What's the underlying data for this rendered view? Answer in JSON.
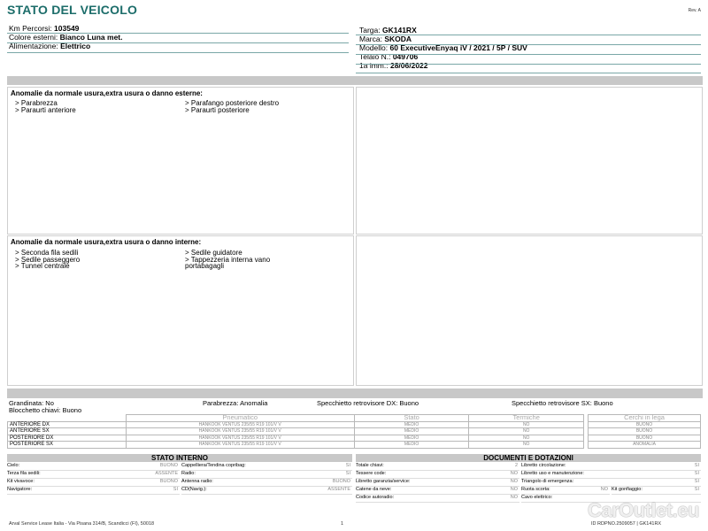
{
  "header": {
    "title": "STATO DEL VEICOLO",
    "rev": "Rev. A"
  },
  "vehicle_left": [
    {
      "label": "Km Percorsi:",
      "value": "103549"
    },
    {
      "label": "Colore esterni:",
      "value": "Bianco Luna met."
    },
    {
      "label": "Alimentazione:",
      "value": "Elettrico"
    }
  ],
  "vehicle_right": [
    {
      "label": "Targa:",
      "value": "GK141RX"
    },
    {
      "label": "Marca:",
      "value": "SKODA"
    },
    {
      "label": "Modello:",
      "value": "60 ExecutiveEnyaq iV / 2021 / 5P / SUV"
    },
    {
      "label": "Telaio N.:",
      "value": "049706"
    },
    {
      "label": "1a imm.:",
      "value": "28/06/2022"
    }
  ],
  "external": {
    "title": "Anomalie da normale usura,extra usura o danno esterne:",
    "col1": [
      "> Parabrezza",
      "> Paraurti anteriore"
    ],
    "col2": [
      "> Parafango posteriore destro",
      "> Paraurti posteriore"
    ]
  },
  "internal": {
    "title": "Anomalie da normale usura,extra usura o danno interne:",
    "col1": [
      "> Seconda fila sedili",
      "> Sedile passeggero",
      "> Tunnel centrale"
    ],
    "col2": [
      "> Sedile guidatore",
      "> Tappezzeria interna vano",
      "portabagagli"
    ]
  },
  "summary": {
    "grandinata": "Grandinata: No",
    "parabrezza": "Parabrezza: Anomalia",
    "specchietto_dx": "Specchietto retrovisore DX: Buono",
    "specchietto_sx": "Specchietto retrovisore SX: Buono",
    "blocchetto": "Blocchetto chiavi: Buono"
  },
  "tyres": {
    "headers": [
      "Pneumatico",
      "Stato",
      "Termiche"
    ],
    "rims_header": "Cerchi in lega",
    "rows": [
      {
        "pos": "ANTERIORE DX",
        "model": "HANKOOK VENTUS 235/55 R19 101/V V",
        "stato": "MEDIO",
        "termiche": "NO",
        "cerchi": "BUONO"
      },
      {
        "pos": "ANTERIORE SX",
        "model": "HANKOOK VENTUS 235/55 R19 101/V V",
        "stato": "MEDIO",
        "termiche": "NO",
        "cerchi": "BUONO"
      },
      {
        "pos": "POSTERIORE DX",
        "model": "HANKOOK VENTUS 235/55 R19 101/V V",
        "stato": "MEDIO",
        "termiche": "NO",
        "cerchi": "BUONO"
      },
      {
        "pos": "POSTERIORE SX",
        "model": "HANKOOK VENTUS 235/55 R19 101/V V",
        "stato": "MEDIO",
        "termiche": "NO",
        "cerchi": "ANOMALIA"
      }
    ]
  },
  "stato_interno": {
    "title": "STATO INTERNO",
    "left": [
      {
        "label": "Cielo:",
        "value": "BUONO"
      },
      {
        "label": "Terza fila sedili:",
        "value": "ASSENTE"
      },
      {
        "label": "Kit vivavoce:",
        "value": "BUONO"
      },
      {
        "label": "Navigatore:",
        "value": "SI"
      }
    ],
    "right": [
      {
        "label": "Cappelliera/Tendina copribag:",
        "value": "SI"
      },
      {
        "label": "Radio:",
        "value": "SI"
      },
      {
        "label": "Antenna radio:",
        "value": "BUONO"
      },
      {
        "label": "CD(Navig.):",
        "value": "ASSENTE"
      }
    ]
  },
  "documenti": {
    "title": "DOCUMENTI E DOTAZIONI",
    "left": [
      {
        "label": "Totale chiavi:",
        "value": "2"
      },
      {
        "label": "Tessere code:",
        "value": "NO"
      },
      {
        "label": "Libretto garanzia/service:",
        "value": "NO"
      },
      {
        "label": "Catene da neve:",
        "value": "NO"
      },
      {
        "label": "Codice autoradio:",
        "value": "NO"
      }
    ],
    "right": [
      {
        "label": "Libretto circolazione:",
        "value": "SI"
      },
      {
        "label": "Libretto uso e manutenzione:",
        "value": "SI"
      },
      {
        "label": "Triangolo di emergenza:",
        "value": "SI"
      },
      {
        "label": "Ruota scorta:",
        "value": "NO"
      },
      {
        "label": "Cavo elettrico:",
        "value": ""
      }
    ],
    "kit_gonfiaggio": {
      "label": "Kit gonfiaggio:",
      "value": "SI"
    }
  },
  "footer": {
    "company": "Arval Service Lease Italia - Via Pisana 314/B, Scandicci (FI), 50018",
    "page": "1",
    "ref": "ID RDPNO.2509057 | GK141RX"
  },
  "watermark": "CarOutlet.eu"
}
